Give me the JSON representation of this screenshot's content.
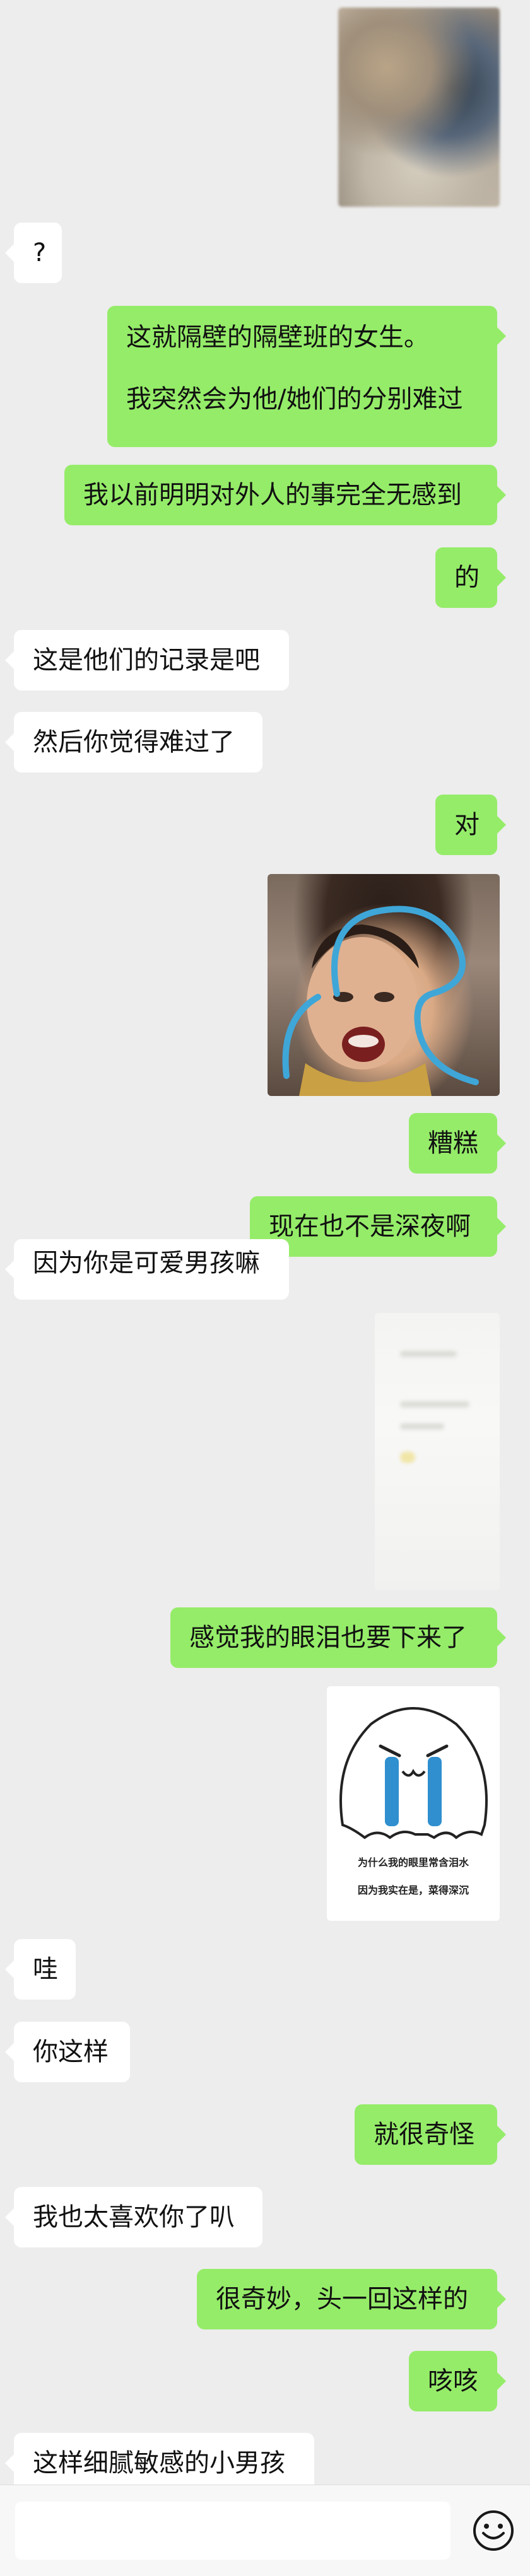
{
  "messages": [
    {
      "id": "m1",
      "side": "left",
      "lines": [
        "?"
      ]
    },
    {
      "id": "m2",
      "side": "right",
      "lines": [
        "这就隔壁的隔壁班的女生。",
        "",
        "我突然会为他/她们的分别难过"
      ]
    },
    {
      "id": "m3",
      "side": "right",
      "lines": [
        "我以前明明对外人的事完全无感到"
      ]
    },
    {
      "id": "m4",
      "side": "right",
      "lines": [
        "的"
      ]
    },
    {
      "id": "m5",
      "side": "left",
      "lines": [
        "这是他们的记录是吧"
      ]
    },
    {
      "id": "m6",
      "side": "left",
      "lines": [
        "然后你觉得难过了"
      ]
    },
    {
      "id": "m7",
      "side": "right",
      "lines": [
        "对"
      ]
    },
    {
      "id": "m8",
      "side": "right",
      "lines": [
        "糟糕"
      ]
    },
    {
      "id": "m9",
      "side": "right",
      "lines": [
        "现在也不是深夜啊"
      ]
    },
    {
      "id": "m10",
      "side": "left",
      "lines": [
        "因为你是可爱男孩嘛"
      ]
    },
    {
      "id": "m11",
      "side": "right",
      "lines": [
        "感觉我的眼泪也要下来了"
      ]
    },
    {
      "id": "m12",
      "side": "left",
      "lines": [
        "哇"
      ]
    },
    {
      "id": "m13",
      "side": "left",
      "lines": [
        "你这样"
      ]
    },
    {
      "id": "m14",
      "side": "right",
      "lines": [
        "就很奇怪"
      ]
    },
    {
      "id": "m15",
      "side": "left",
      "lines": [
        "我也太喜欢你了叭"
      ]
    },
    {
      "id": "m16",
      "side": "right",
      "lines": [
        "很奇妙，头一回这样的"
      ]
    },
    {
      "id": "m17",
      "side": "right",
      "lines": [
        "咳咳"
      ]
    },
    {
      "id": "m18",
      "side": "left",
      "lines": [
        "这样细腻敏感的小男孩"
      ]
    }
  ],
  "images": {
    "photo_top": {
      "icon": "blurred-photo"
    },
    "crying_meme": {
      "icon": "crying-boy-meme"
    },
    "blurred_screenshot": {
      "icon": "blurred-screenshot"
    },
    "tears_meme": {
      "icon": "crying-ghost-meme",
      "caption_line1": "为什么我的眼里常含泪水",
      "caption_line2": "因为我实在是，菜得深沉"
    }
  },
  "input_bar": {
    "emoji_icon": "smiley-face-icon"
  },
  "colors": {
    "background": "#ededed",
    "bubble_self": "#95ec69",
    "bubble_other": "#ffffff"
  }
}
